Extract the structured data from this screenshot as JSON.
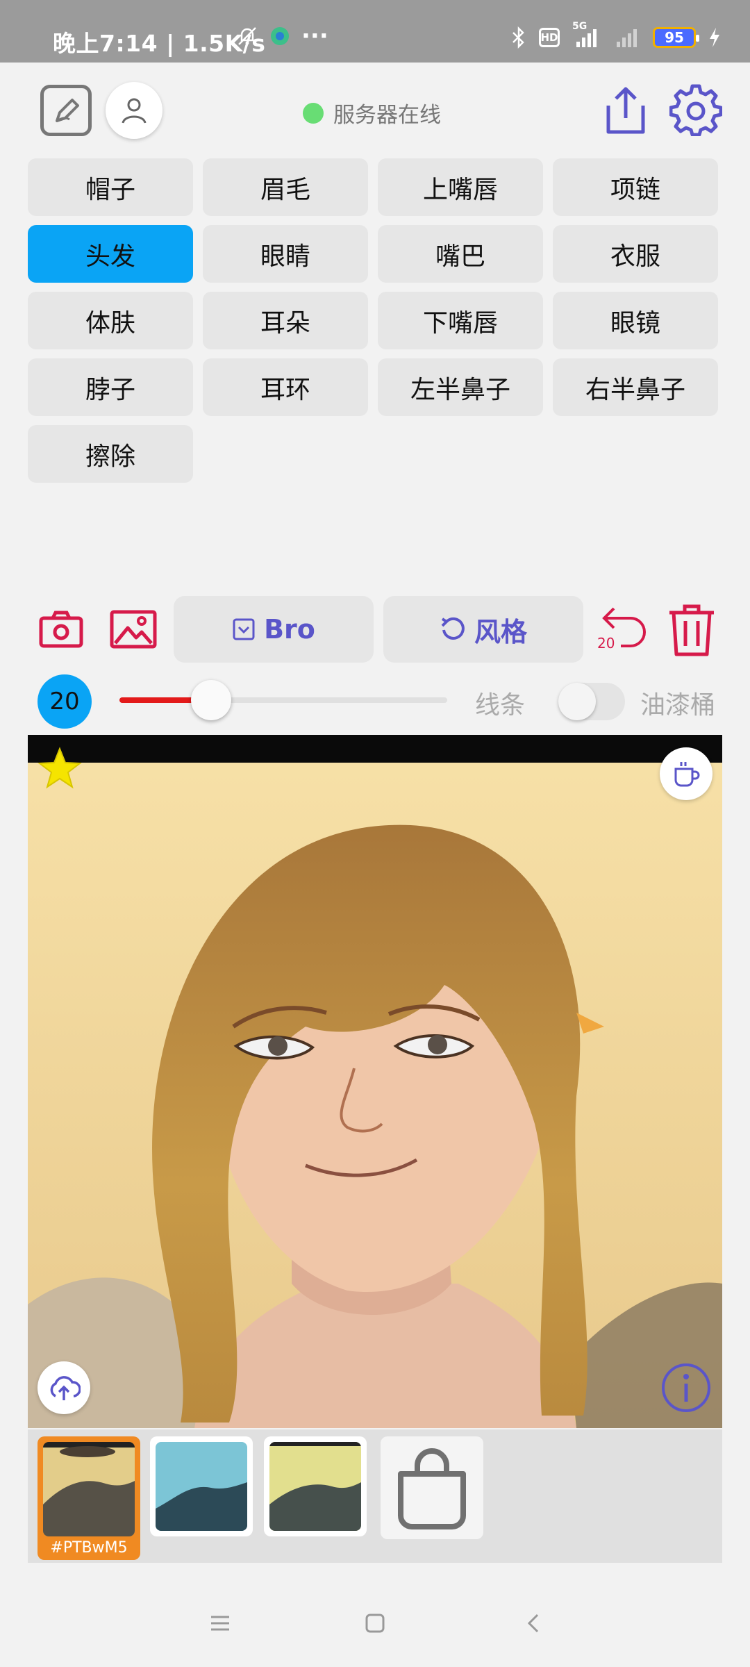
{
  "status_bar": {
    "time": "晚上7:14 | 1.5K/s",
    "more": "···",
    "hd": "HD",
    "network": "5G",
    "battery": "95"
  },
  "top_bar": {
    "server_status": "服务器在线",
    "status_color": "#68dd74"
  },
  "categories": [
    {
      "label": "帽子",
      "active": false
    },
    {
      "label": "眉毛",
      "active": false
    },
    {
      "label": "上嘴唇",
      "active": false
    },
    {
      "label": "项链",
      "active": false
    },
    {
      "label": "头发",
      "active": true
    },
    {
      "label": "眼睛",
      "active": false
    },
    {
      "label": "嘴巴",
      "active": false
    },
    {
      "label": "衣服",
      "active": false
    },
    {
      "label": "体肤",
      "active": false
    },
    {
      "label": "耳朵",
      "active": false
    },
    {
      "label": "下嘴唇",
      "active": false
    },
    {
      "label": "眼镜",
      "active": false
    },
    {
      "label": "脖子",
      "active": false
    },
    {
      "label": "耳环",
      "active": false
    },
    {
      "label": "左半鼻子",
      "active": false
    },
    {
      "label": "右半鼻子",
      "active": false
    },
    {
      "label": "擦除",
      "active": false
    }
  ],
  "toolbar": {
    "bro_label": "Bro",
    "style_label": "风格",
    "undo_count": "20",
    "accent_color": "#d61a4a",
    "pill_text_color": "#5a55c9"
  },
  "brush": {
    "size": "20",
    "slider_fraction": 0.28,
    "lines_label": "线条",
    "bucket_label": "油漆桶",
    "bucket_enabled": false
  },
  "thumbnails": {
    "selected_tag": "#PTBwM5"
  },
  "colors": {
    "active_category": "#0aa4f5",
    "slider_fill": "#e31a1a",
    "selected_thumb_border": "#f08a22"
  }
}
